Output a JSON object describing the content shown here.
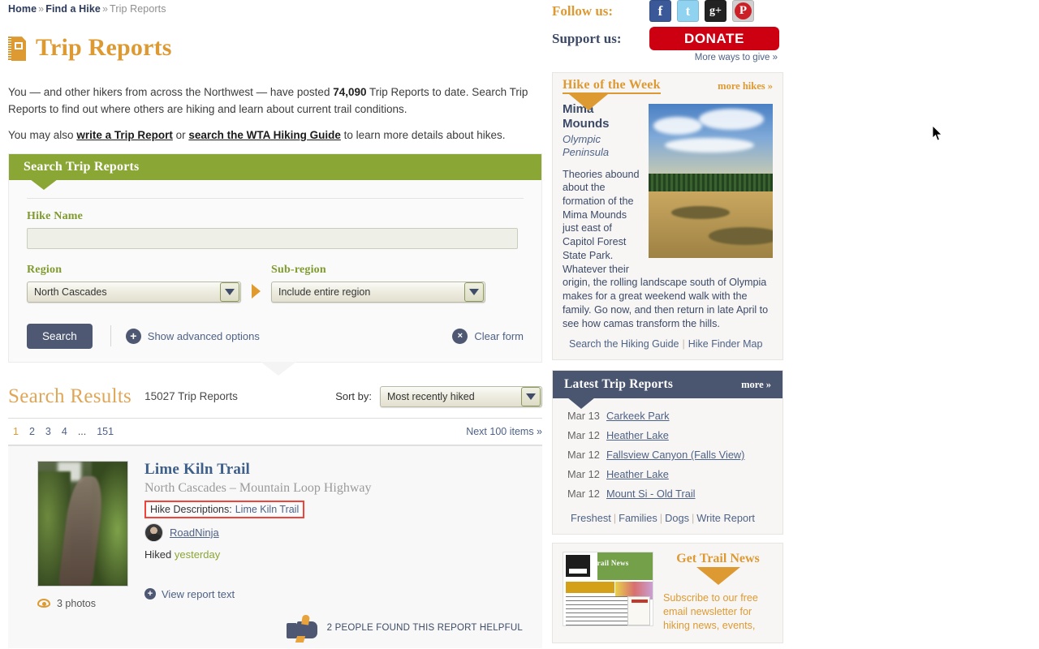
{
  "breadcrumb": {
    "home": "Home",
    "find_a_hike": "Find a Hike",
    "current": "Trip Reports",
    "sep": "»"
  },
  "header": {
    "title": "Trip Reports",
    "icon": "notebook-icon"
  },
  "intro": {
    "line1_pre": "You — and other hikers from across the Northwest — have posted ",
    "count": "74,090",
    "line1_post": " Trip Reports to date. Search Trip Reports to find out where others are hiking and learn about current trail conditions.",
    "line2_pre": "You may also ",
    "link_write": "write a Trip Report",
    "line2_mid": " or ",
    "link_guide": "search the WTA Hiking Guide",
    "line2_post": " to learn more details about hikes."
  },
  "search_panel": {
    "heading": "Search Trip Reports",
    "hike_name_label": "Hike Name",
    "hike_name_value": "",
    "hike_name_placeholder": "",
    "region_label": "Region",
    "region_value": "North Cascades",
    "subregion_label": "Sub-region",
    "subregion_value": "Include entire region",
    "search_button": "Search",
    "advanced_options": "Show advanced options",
    "clear_form": "Clear form",
    "plus_glyph": "+",
    "x_glyph": "×"
  },
  "results": {
    "title": "Search Results",
    "count": "15027 Trip Reports",
    "sort_label": "Sort by:",
    "sort_value": "Most recently hiked",
    "pages": [
      "1",
      "2",
      "3",
      "4"
    ],
    "ellipsis": "...",
    "last_page": "151",
    "next": "Next 100 items »"
  },
  "trip_report": {
    "title": "Lime Kiln Trail",
    "subtitle": "North Cascades – Mountain Loop Highway",
    "hike_descriptions_label": "Hike Descriptions:",
    "hike_descriptions_link": "Lime Kiln Trail",
    "author": "RoadNinja",
    "hiked_label": "Hiked",
    "hiked_when": "yesterday",
    "view_report": "View report text",
    "photos": "3 photos",
    "helpful": "2 PEOPLE FOUND THIS REPORT HELPFUL"
  },
  "sidebar": {
    "follow_label": "Follow us:",
    "support_label": "Support us:",
    "social": [
      {
        "name": "facebook-icon",
        "glyph": "f"
      },
      {
        "name": "twitter-icon",
        "glyph": "t"
      },
      {
        "name": "googleplus-icon",
        "glyph": "g+"
      },
      {
        "name": "pinterest-icon",
        "glyph": "P"
      }
    ],
    "donate": "DONATE",
    "more_ways": "More ways to give »",
    "hike_of_week": {
      "heading": "Hike of the Week",
      "more_link": "more hikes »",
      "name": "Mima Mounds",
      "region": "Olympic Peninsula",
      "description": "Theories abound about the formation of the Mima Mounds just east of Capitol Forest State Park. Whatever their origin, the rolling landscape south of Olympia makes for a great weekend walk with the family. Go now, and then return in late April to see how camas transform the hills.",
      "link_guide": "Search the Hiking Guide",
      "link_map": "Hike Finder Map",
      "separator": "|"
    },
    "latest_trip_reports": {
      "heading": "Latest Trip Reports",
      "more_link": "more »",
      "rows": [
        {
          "date": "Mar 13",
          "name": "Carkeek Park"
        },
        {
          "date": "Mar 12",
          "name": "Heather Lake"
        },
        {
          "date": "Mar 12",
          "name": "Fallsview Canyon (Falls View)"
        },
        {
          "date": "Mar 12",
          "name": "Heather Lake"
        },
        {
          "date": "Mar 12",
          "name": "Mount Si - Old Trail"
        }
      ],
      "footer_links": [
        "Freshest",
        "Families",
        "Dogs",
        "Write Report"
      ],
      "separator": "|"
    },
    "trail_news": {
      "heading": "Get Trail News",
      "text": "Subscribe to our free email newsletter for hiking news, events,",
      "thumb_title": "Trail News"
    }
  },
  "colors": {
    "green": "#8aa635",
    "gold": "#dd9a33",
    "navy": "#4a5570",
    "link_blue": "#4e6286",
    "red_highlight": "#f0433a",
    "donate_red": "#cc0011"
  }
}
